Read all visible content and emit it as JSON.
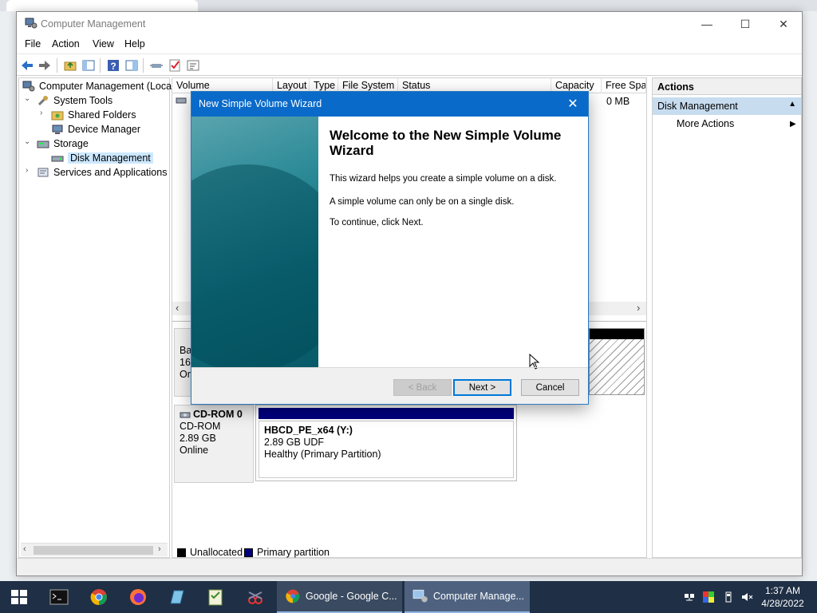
{
  "window": {
    "title": "Computer Management",
    "minimize_glyph": "—",
    "maximize_glyph": "☐",
    "close_glyph": "✕"
  },
  "menu": [
    "File",
    "Action",
    "View",
    "Help"
  ],
  "toolbar_icons": [
    "back-arrow-icon",
    "forward-arrow-icon",
    "up-folder-icon",
    "show-hide-tree-icon",
    "help-icon",
    "properties-icon",
    "connect-icon",
    "checklist-icon",
    "settings-panel-icon"
  ],
  "tree": {
    "root": "Computer Management (Local",
    "items": [
      {
        "label": "System Tools",
        "icon": "tools-icon"
      },
      {
        "label": "Shared Folders",
        "icon": "shared-folder-icon"
      },
      {
        "label": "Device Manager",
        "icon": "device-manager-icon"
      },
      {
        "label": "Storage",
        "icon": "storage-icon"
      },
      {
        "label": "Disk Management",
        "icon": "disk-icon"
      },
      {
        "label": "Services and Applications",
        "icon": "services-icon"
      }
    ]
  },
  "volume_list": {
    "columns": [
      "Volume",
      "Layout",
      "Type",
      "File System",
      "Status",
      "Capacity",
      "Free Spac"
    ],
    "row_free": "0 MB"
  },
  "disks": {
    "disk0_partial": [
      "Ba",
      "16",
      "Or"
    ],
    "cdrom": {
      "name": "CD-ROM 0",
      "type": "CD-ROM",
      "size": "2.89 GB",
      "status": "Online",
      "partition_name": "HBCD_PE_x64  (Y:)",
      "partition_size": "2.89 GB UDF",
      "partition_status": "Healthy (Primary Partition)"
    }
  },
  "legend": [
    "Unallocated",
    "Primary partition"
  ],
  "actions": {
    "header": "Actions",
    "section": "Disk Management",
    "more": "More Actions"
  },
  "wizard": {
    "title": "New Simple Volume Wizard",
    "heading": "Welcome to the New Simple Volume Wizard",
    "p1": "This wizard helps you create a simple volume on a disk.",
    "p2": "A simple volume can only be on a single disk.",
    "p3": "To continue, click Next.",
    "back": "< Back",
    "next": "Next >",
    "cancel": "Cancel"
  },
  "taskbar": {
    "apps": [
      {
        "label": "Google - Google C..."
      },
      {
        "label": "Computer Manage..."
      }
    ],
    "time": "1:37 AM",
    "date": "4/28/2022"
  },
  "colors": {
    "primary_partition": "#00007f",
    "unallocated": "#000000",
    "taskbar": "#1f2f45",
    "wizard_title": "#0a6ac9"
  }
}
